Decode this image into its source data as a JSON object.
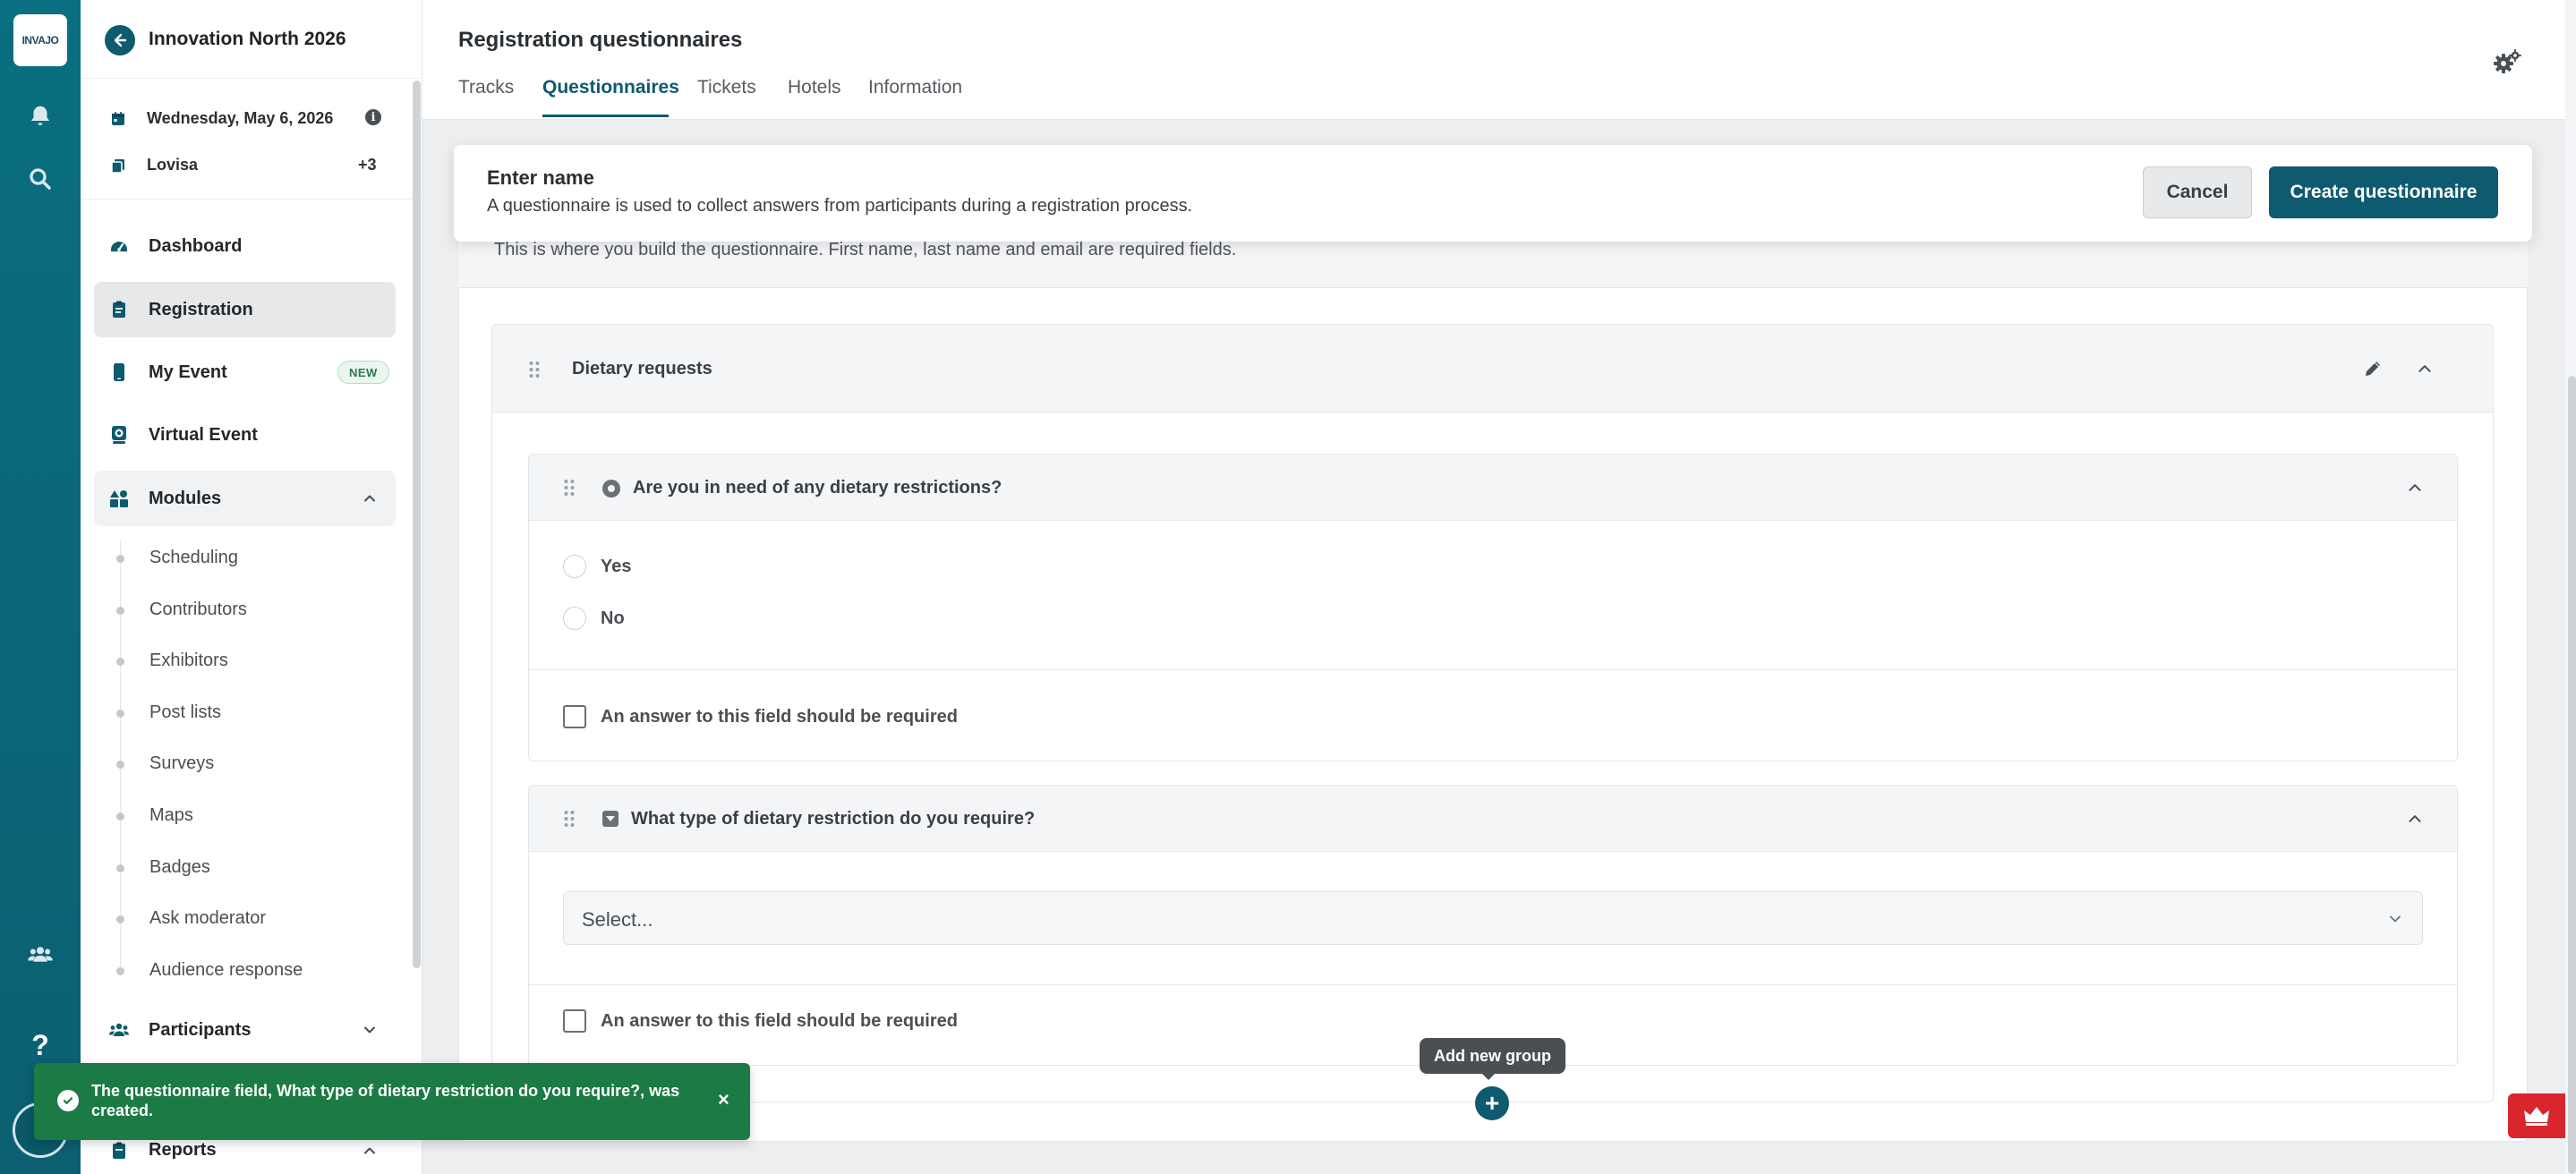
{
  "rail": {
    "logo_text": "INVAJO",
    "icons": [
      "bell-icon",
      "search-icon",
      "users-icon",
      "help-icon"
    ]
  },
  "sidebar": {
    "event_title": "Innovation North 2026",
    "date": "Wednesday, May 6, 2026",
    "organizer": "Lovisa",
    "organizer_more": "+3",
    "nav": {
      "dashboard": "Dashboard",
      "registration": "Registration",
      "my_event": "My Event",
      "my_event_badge": "NEW",
      "virtual_event": "Virtual Event",
      "modules": "Modules",
      "participants": "Participants",
      "reports": "Reports"
    },
    "modules": [
      "Scheduling",
      "Contributors",
      "Exhibitors",
      "Post lists",
      "Surveys",
      "Maps",
      "Badges",
      "Ask moderator",
      "Audience response"
    ]
  },
  "header": {
    "title": "Registration questionnaires",
    "tabs": [
      "Tracks",
      "Questionnaires",
      "Tickets",
      "Hotels",
      "Information"
    ],
    "active_tab": "Questionnaires"
  },
  "modal": {
    "title": "Enter name",
    "subtitle": "A questionnaire is used to collect answers from participants during a registration process.",
    "cancel": "Cancel",
    "create": "Create questionnaire"
  },
  "builder": {
    "hint": "This is where you build the questionnaire. First name, last name and email are required fields.",
    "group_title": "Dietary requests",
    "fields": [
      {
        "title": "Are you in need of any dietary restrictions?",
        "type": "radio",
        "options": [
          "Yes",
          "No"
        ],
        "required_label": "An answer to this field should be required"
      },
      {
        "title": "What type of dietary restriction do you require?",
        "type": "select",
        "placeholder": "Select...",
        "required_label": "An answer to this field should be required"
      }
    ],
    "add_group_tooltip": "Add new group",
    "add_group_symbol": "+"
  },
  "toast": {
    "message": "The questionnaire field, What type of dietary restriction do you require?, was created.",
    "close": "×"
  },
  "colors": {
    "brand": "#0e5a6e",
    "rail": "#0a6f80",
    "success": "#1c7a45",
    "alert": "#d9262c"
  }
}
